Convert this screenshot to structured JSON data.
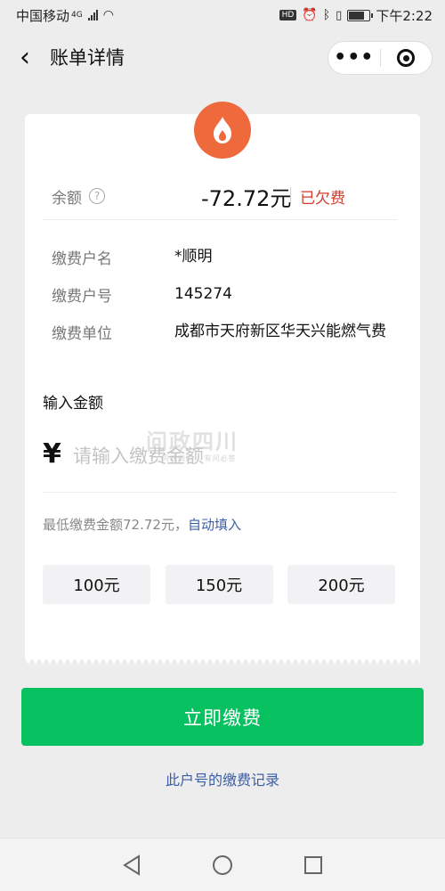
{
  "status_bar": {
    "carrier": "中国移动",
    "network": "4G",
    "time": "下午2:22",
    "battery_level": 0.82
  },
  "navbar": {
    "title": "账单详情",
    "more_label": "•••"
  },
  "bill": {
    "balance_label": "余额",
    "balance_amount": "-72.72元",
    "status": "已欠费",
    "fields": [
      {
        "label": "缴费户名",
        "value": "*顺明"
      },
      {
        "label": "缴费户号",
        "value": "145274"
      },
      {
        "label": "缴费单位",
        "value": "成都市天府新区华天兴能燃气费"
      }
    ]
  },
  "payment": {
    "input_title": "输入金额",
    "currency_symbol": "¥",
    "input_placeholder": "请输入缴费金额",
    "input_value": "",
    "min_amount_text": "最低缴费金额72.72元，",
    "autofill_label": "自动填入",
    "quick_amounts": [
      "100元",
      "150元",
      "200元"
    ]
  },
  "watermark": {
    "title": "问政四川",
    "subtitle": "问政四川 · 有问必答"
  },
  "actions": {
    "pay_button": "立即缴费",
    "record_link": "此户号的缴费记录"
  },
  "colors": {
    "accent_green": "#07c160",
    "flame_orange": "#ee6a3c",
    "owe_red": "#d23a2c",
    "link_blue": "#3b5fa6"
  }
}
